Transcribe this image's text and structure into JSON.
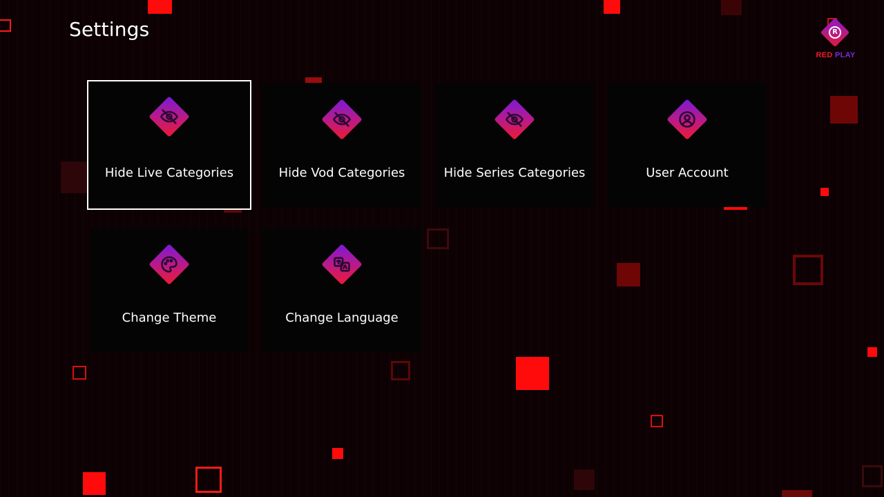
{
  "header": {
    "title": "Settings"
  },
  "brand": {
    "letter": "R",
    "name_part1": "RED",
    "name_part2": "PLAY"
  },
  "tiles": [
    {
      "label": "Hide Live Categories",
      "icon": "eye-off-icon",
      "focused": true
    },
    {
      "label": "Hide Vod Categories",
      "icon": "eye-off-icon",
      "focused": false
    },
    {
      "label": "Hide Series Categories",
      "icon": "eye-off-icon",
      "focused": false
    },
    {
      "label": "User Account",
      "icon": "user-icon",
      "focused": false
    },
    {
      "label": "Change Theme",
      "icon": "palette-icon",
      "focused": false
    },
    {
      "label": "Change Language",
      "icon": "translate-icon",
      "focused": false
    }
  ],
  "colors": {
    "background": "#0d0103",
    "accent_red": "#ff0b0b",
    "accent_purple": "#7a1ad8",
    "tile_bg": "#040404",
    "focus_border": "#ffffff"
  }
}
